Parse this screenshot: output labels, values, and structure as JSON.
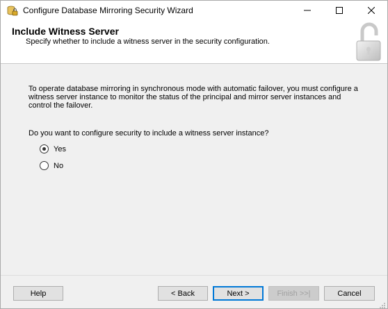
{
  "window": {
    "title": "Configure Database Mirroring Security Wizard",
    "controls": {
      "minimize_icon": "minimize-icon",
      "maximize_icon": "maximize-icon",
      "close_icon": "close-icon"
    }
  },
  "header": {
    "title": "Include Witness Server",
    "subtitle": "Specify whether to include a witness server in the security configuration.",
    "icon": "padlock-icon"
  },
  "main": {
    "description": "To operate database mirroring in synchronous mode with automatic failover, you must configure a witness server instance to monitor the status of the principal and mirror server instances and control the failover.",
    "question": "Do you want to configure security to include a witness server instance?",
    "options": [
      {
        "label": "Yes",
        "selected": true
      },
      {
        "label": "No",
        "selected": false
      }
    ]
  },
  "footer": {
    "help_label": "Help",
    "back_label": "< Back",
    "next_label": "Next >",
    "finish_label": "Finish >>|",
    "cancel_label": "Cancel"
  },
  "colors": {
    "window_bg": "#f0f0f0",
    "header_bg": "#ffffff",
    "default_button_border": "#0078d7",
    "disabled_text": "#a0a0a0"
  }
}
